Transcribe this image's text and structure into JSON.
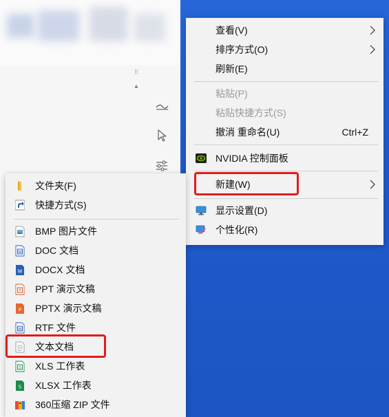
{
  "colors": {
    "accent_highlight": "#e21b1b",
    "desktop_blue": "#2566d8",
    "menu_bg": "#f2f2f2",
    "disabled_text": "#9a9a9a",
    "nvidia_green": "#76b900"
  },
  "context_menu": {
    "items": [
      {
        "label": "查看(V)",
        "submenu": true,
        "disabled": false
      },
      {
        "label": "排序方式(O)",
        "submenu": true,
        "disabled": false
      },
      {
        "label": "刷新(E)",
        "submenu": false,
        "disabled": false
      },
      {
        "label": "粘贴(P)",
        "submenu": false,
        "disabled": true
      },
      {
        "label": "粘贴快捷方式(S)",
        "submenu": false,
        "disabled": true
      },
      {
        "label": "撤消 重命名(U)",
        "shortcut": "Ctrl+Z",
        "submenu": false,
        "disabled": false
      },
      {
        "label": "NVIDIA 控制面板",
        "icon": "nvidia-icon",
        "submenu": false,
        "disabled": false
      },
      {
        "label": "新建(W)",
        "submenu": true,
        "disabled": false,
        "highlighted": true
      },
      {
        "label": "显示设置(D)",
        "icon": "display-settings-icon",
        "submenu": false,
        "disabled": false
      },
      {
        "label": "个性化(R)",
        "icon": "personalize-icon",
        "submenu": false,
        "disabled": false
      }
    ]
  },
  "new_submenu": {
    "items": [
      {
        "label": "文件夹(F)",
        "icon": "folder-icon"
      },
      {
        "label": "快捷方式(S)",
        "icon": "shortcut-icon"
      },
      {
        "label": "BMP 图片文件",
        "icon": "bmp-file-icon"
      },
      {
        "label": "DOC 文档",
        "icon": "doc-file-icon"
      },
      {
        "label": "DOCX 文档",
        "icon": "docx-file-icon"
      },
      {
        "label": "PPT 演示文稿",
        "icon": "ppt-file-icon"
      },
      {
        "label": "PPTX 演示文稿",
        "icon": "pptx-file-icon"
      },
      {
        "label": "RTF 文件",
        "icon": "rtf-file-icon"
      },
      {
        "label": "文本文档",
        "icon": "txt-file-icon",
        "highlighted": true
      },
      {
        "label": "XLS 工作表",
        "icon": "xls-file-icon"
      },
      {
        "label": "XLSX 工作表",
        "icon": "xlsx-file-icon"
      },
      {
        "label": "360压缩 ZIP 文件",
        "icon": "zip-file-icon"
      }
    ]
  },
  "side_icons": [
    "pen-icon",
    "cursor-icon",
    "sliders-icon"
  ]
}
